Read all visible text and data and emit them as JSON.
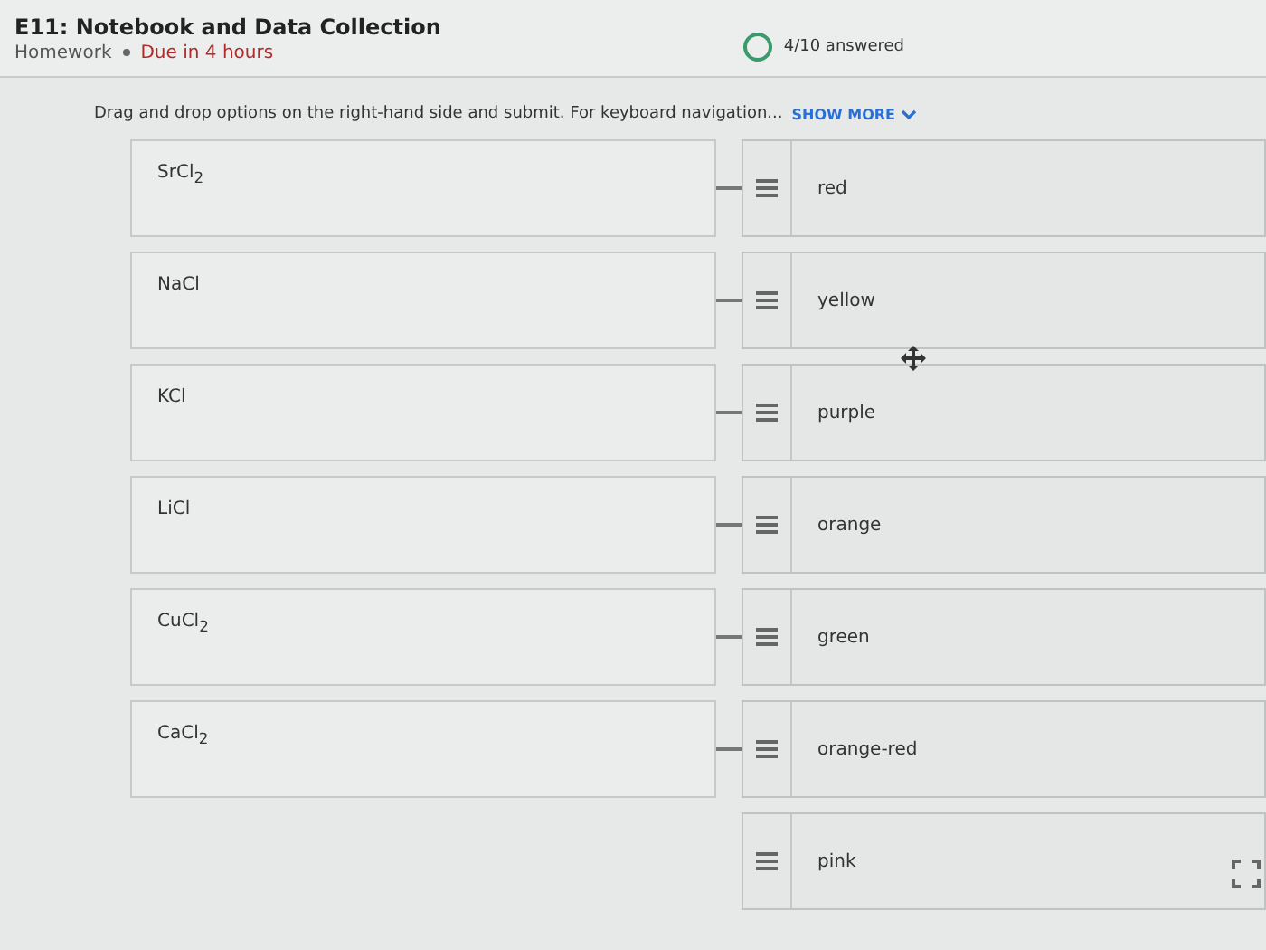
{
  "header": {
    "title": "E11: Notebook and Data Collection",
    "category": "Homework",
    "due": "Due in 4 hours",
    "progress": "4/10 answered"
  },
  "instructions": {
    "text": "Drag and drop options on the right-hand side and submit. For keyboard navigation...",
    "link": "SHOW MORE"
  },
  "rows": [
    {
      "target": "SrCl$_{2}$",
      "option": "red"
    },
    {
      "target": "NaCl",
      "option": "yellow"
    },
    {
      "target": "KCl",
      "option": "purple"
    },
    {
      "target": "LiCl",
      "option": "orange"
    },
    {
      "target": "CuCl$_{2}$",
      "option": "green"
    },
    {
      "target": "CaCl$_{2}$",
      "option": "orange-red"
    },
    {
      "option": "pink"
    }
  ]
}
